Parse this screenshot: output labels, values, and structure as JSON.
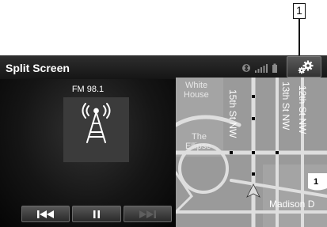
{
  "callout": {
    "number": "1"
  },
  "header": {
    "title": "Split Screen"
  },
  "status_icons": [
    "bluetooth-icon",
    "signal-bars-icon",
    "battery-icon"
  ],
  "settings_icon": "gears-icon",
  "radio": {
    "station": "FM 98.1",
    "art_icon": "antenna-tower-icon",
    "controls": [
      {
        "name": "previous-track-button",
        "icon": "skip-back-icon",
        "enabled": true
      },
      {
        "name": "pause-button",
        "icon": "pause-icon",
        "enabled": true
      },
      {
        "name": "next-track-button",
        "icon": "skip-forward-icon",
        "enabled": false
      }
    ]
  },
  "map": {
    "labels": {
      "white_house": "White House",
      "ellipse": "The Ellipse",
      "st15": "15th St NW",
      "st13": "13th St NW",
      "st12": "12th St NW",
      "madison": "Madison D",
      "route": "1"
    },
    "colors": {
      "land": "#9a9a9a",
      "road": "#dedede",
      "route_shield": "#ffffff"
    }
  }
}
